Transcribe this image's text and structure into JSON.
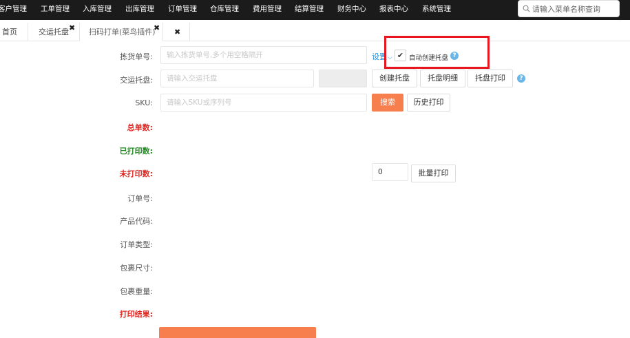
{
  "nav": {
    "items": [
      "客户管理",
      "工单管理",
      "入库管理",
      "出库管理",
      "订单管理",
      "仓库管理",
      "费用管理",
      "结算管理",
      "财务中心",
      "报表中心",
      "系统管理"
    ],
    "search_placeholder": "请输入菜单名称查询",
    "search_icon": "search-icon"
  },
  "tabs": [
    {
      "label": "首页"
    },
    {
      "label": "交运托盘",
      "close": "✖"
    },
    {
      "label": "扫码打单(菜鸟插件)",
      "close": "✖"
    },
    {
      "label": "",
      "close": "✖"
    }
  ],
  "form": {
    "pick_label": "拣货单号:",
    "pick_placeholder": "输入拣货单号,多个用空格隔开",
    "settings_link": "设置",
    "settings_caret": "⌵",
    "auto_checkbox": "✔",
    "auto_label": "自动创建托盘",
    "help_char": "?",
    "pallet_label": "交运托盘:",
    "pallet_placeholder": "请输入交运托盘",
    "create_pallet": "创建托盘",
    "pallet_detail": "托盘明细",
    "pallet_print": "托盘打印",
    "sku_label": "SKU:",
    "sku_placeholder": "请输入SKU或序列号",
    "search_btn": "搜索",
    "history_print": "历史打印",
    "total_label": "总单数:",
    "printed_label": "已打印数:",
    "unprinted_label": "未打印数:",
    "batch_qty": "0",
    "batch_print": "批量打印",
    "order_no_label": "订单号:",
    "product_code_label": "产品代码:",
    "order_type_label": "订单类型:",
    "pkg_size_label": "包裹尺寸:",
    "pkg_weight_label": "包裹重量:",
    "print_result_label": "打印结果:"
  }
}
